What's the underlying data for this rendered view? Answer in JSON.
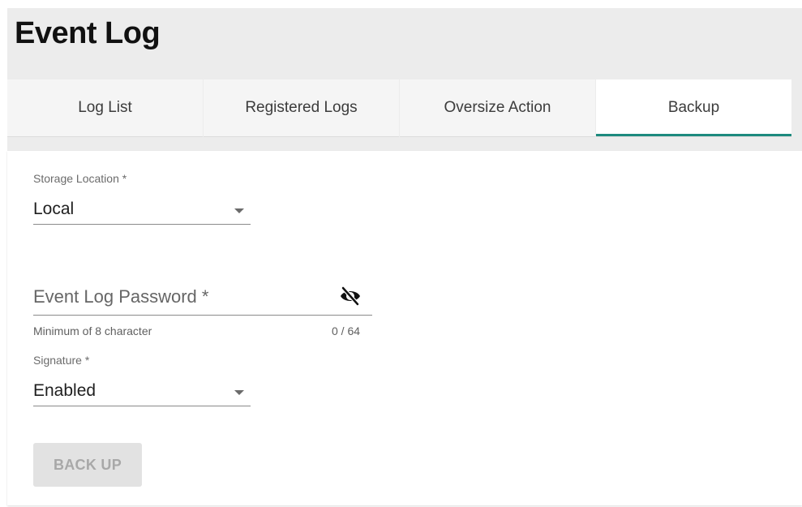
{
  "page_title": "Event Log",
  "tabs": [
    {
      "label": "Log List",
      "active": false
    },
    {
      "label": "Registered Logs",
      "active": false
    },
    {
      "label": "Oversize Action",
      "active": false
    },
    {
      "label": "Backup",
      "active": true
    }
  ],
  "form": {
    "storage_location": {
      "label": "Storage Location *",
      "value": "Local"
    },
    "password": {
      "placeholder": "Event Log Password *",
      "hint": "Minimum of 8 character",
      "counter": "0 / 64",
      "visibility_icon": "eye-off-icon"
    },
    "signature": {
      "label": "Signature *",
      "value": "Enabled"
    },
    "backup_button": {
      "label": "BACK UP",
      "enabled": false
    }
  },
  "colors": {
    "accent": "#1d8a7e",
    "page_background": "#ececec",
    "disabled_button": "#e2e2e2"
  }
}
